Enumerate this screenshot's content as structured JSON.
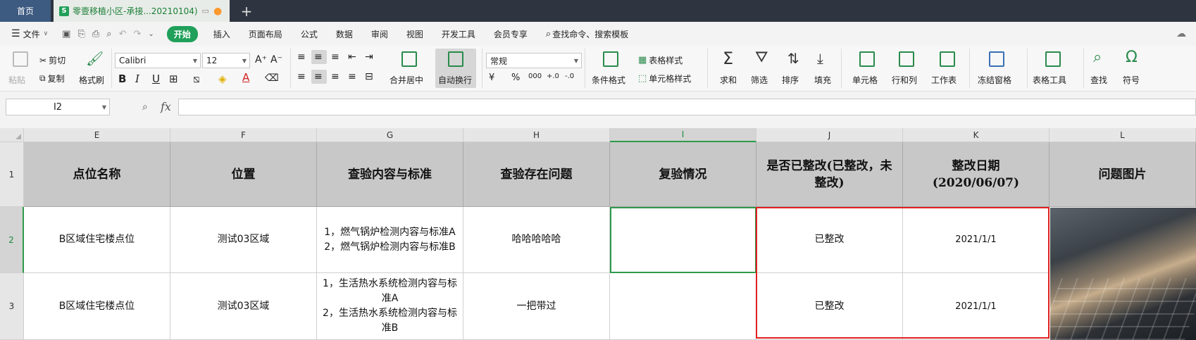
{
  "tabs": {
    "home": "首页",
    "doc": "零壹移植小区-承接...20210104)",
    "doc_icon": "S",
    "add": "+"
  },
  "menubar": {
    "file": "文件",
    "start": "开始",
    "items": [
      "插入",
      "页面布局",
      "公式",
      "数据",
      "审阅",
      "视图",
      "开发工具",
      "会员专享"
    ],
    "search": "查找命令、搜索模板"
  },
  "ribbon": {
    "paste": "粘贴",
    "cut": "剪切",
    "copy": "复制",
    "format_painter": "格式刷",
    "font_name": "Calibri",
    "font_size": "12",
    "merge_center": "合并居中",
    "wrap_text": "自动换行",
    "number_format": "常规",
    "cond_format": "条件格式",
    "table_style": "表格样式",
    "cell_style": "单元格样式",
    "sum": "求和",
    "filter": "筛选",
    "sort": "排序",
    "fill": "填充",
    "cells": "单元格",
    "rows_cols": "行和列",
    "worksheet": "工作表",
    "freeze": "冻结窗格",
    "table_tools": "表格工具",
    "find": "查找",
    "symbol": "符号"
  },
  "formula_bar": {
    "name_box": "I2",
    "fx": "fx",
    "value": ""
  },
  "columns": [
    "E",
    "F",
    "G",
    "H",
    "I",
    "J",
    "K",
    "L"
  ],
  "rows": [
    "1",
    "2",
    "3"
  ],
  "header_row": [
    "点位名称",
    "位置",
    "查验内容与标准",
    "查验存在问题",
    "复验情况",
    "是否已整改(已整改，未整改)",
    "整改日期(2020/06/07)",
    "问题图片"
  ],
  "data_rows": [
    [
      "B区域住宅楼点位",
      "测试03区域",
      "1，燃气锅炉检测内容与标准A\n2，燃气锅炉检测内容与标准B",
      "哈哈哈哈哈",
      "",
      "已整改",
      "2021/1/1",
      ""
    ],
    [
      "B区域住宅楼点位",
      "测试03区域",
      "1，生活热水系统检测内容与标准A\n2，生活热水系统检测内容与标准B",
      "一把带过",
      "",
      "已整改",
      "2021/1/1",
      ""
    ]
  ],
  "colors": {
    "accent_green": "#20a05a",
    "highlight_red": "#e02020",
    "header_gray": "#c8c8c8"
  }
}
